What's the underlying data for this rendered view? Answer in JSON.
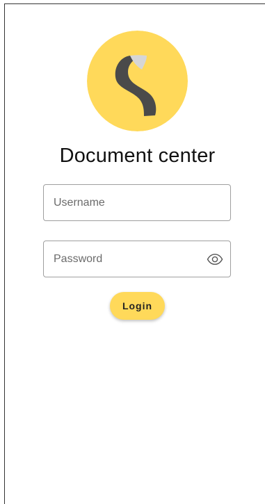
{
  "app": {
    "title": "Document center"
  },
  "brand": {
    "logo_icon": "stylized-s-logo-icon",
    "logo_bg_color": "#ffd95a",
    "logo_dark_color": "#4a4a4a",
    "logo_light_color": "#d6d6d6"
  },
  "form": {
    "username": {
      "placeholder": "Username",
      "value": ""
    },
    "password": {
      "placeholder": "Password",
      "value": "",
      "toggle_icon": "eye-icon"
    },
    "login_label": "Login",
    "accent_color": "#ffd95a"
  }
}
